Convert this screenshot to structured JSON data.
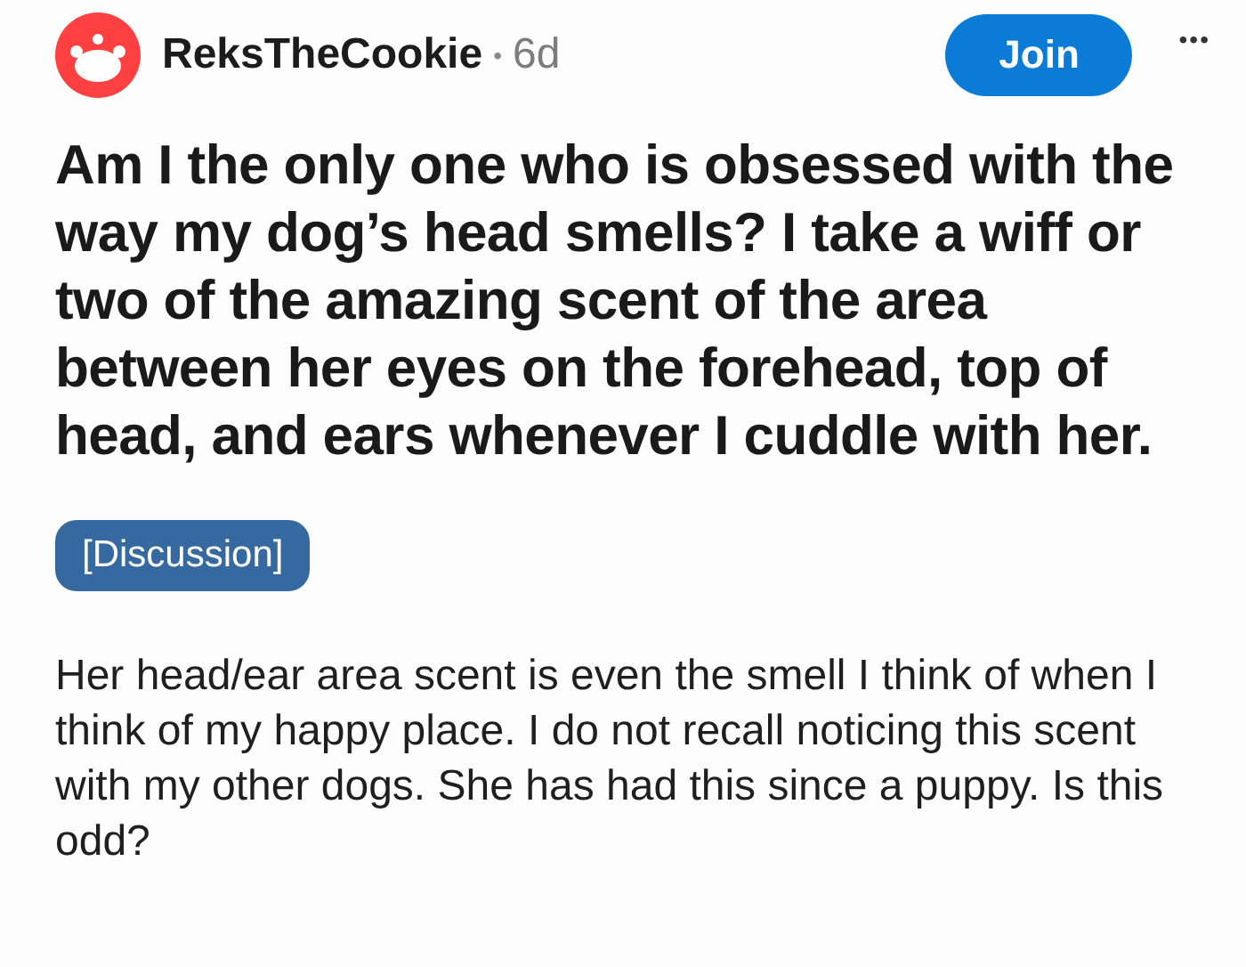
{
  "post": {
    "author": "ReksTheCookie",
    "separator": "•",
    "age": "6d",
    "join_button": "Join",
    "more_button": "•••",
    "title": "Am I the only one who is obsessed with the way my dog’s head smells? I take a wiff or two of the amazing scent of the area between her eyes on the forehead, top of head, and ears whenever I cuddle with her.",
    "flair": "[Discussion]",
    "body": "Her head/ear area scent is even the smell I think of when I think of my happy place. I do not recall noticing this scent with my other dogs. She has had this since a puppy. Is this odd?"
  }
}
